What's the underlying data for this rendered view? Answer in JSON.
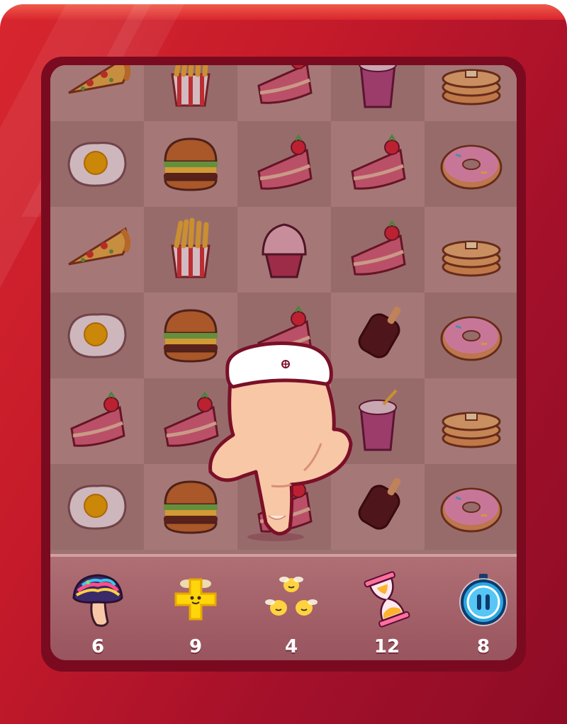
{
  "game": {
    "board": {
      "rows": [
        [
          "pizza-slice",
          "french-fries",
          "strawberry-cake",
          "milkshake",
          "pancakes"
        ],
        [
          "fried-egg",
          "burger",
          "strawberry-cake",
          "strawberry-cake",
          "donut"
        ],
        [
          "pizza-slice",
          "french-fries",
          "cupcake",
          "strawberry-cake",
          "pancakes"
        ],
        [
          "fried-egg",
          "burger",
          "strawberry-cake",
          "ice-cream-bar",
          "donut"
        ],
        [
          "strawberry-cake",
          "strawberry-cake",
          "strawberry-cake",
          "milkshake",
          "pancakes"
        ],
        [
          "fried-egg",
          "burger",
          "strawberry-cake",
          "ice-cream-bar",
          "donut"
        ]
      ]
    },
    "boosters": [
      {
        "name": "rainbow-mushroom",
        "count": "6"
      },
      {
        "name": "plus",
        "count": "9"
      },
      {
        "name": "bees",
        "count": "4"
      },
      {
        "name": "hourglass",
        "count": "12"
      },
      {
        "name": "pause-timer",
        "count": "8"
      }
    ],
    "colors": {
      "frame": "#c41a2a",
      "board": "#b89a92",
      "pause": "#2aa7e0"
    }
  }
}
